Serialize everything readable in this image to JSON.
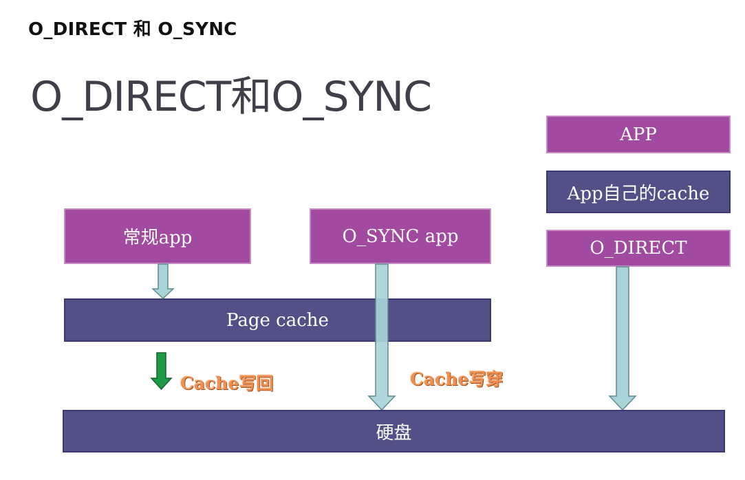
{
  "heading": "O_DIRECT 和 O_SYNC",
  "slide": {
    "title": "O_DIRECT和O_SYNC",
    "boxes": {
      "app": "APP",
      "app_cache": "App自己的cache",
      "o_direct": "O_DIRECT",
      "normal_app": "常规app",
      "o_sync_app": "O_SYNC app",
      "page_cache": "Page cache",
      "disk": "硬盘"
    },
    "notes": {
      "write_back": "Cache写回",
      "write_through": "Cache写穿"
    }
  },
  "colors": {
    "purple": "#a24a9f",
    "navy": "#534f87",
    "arrow_light": "#a8d4d8",
    "arrow_green": "#1f9a47",
    "note": "#ee8f54"
  }
}
